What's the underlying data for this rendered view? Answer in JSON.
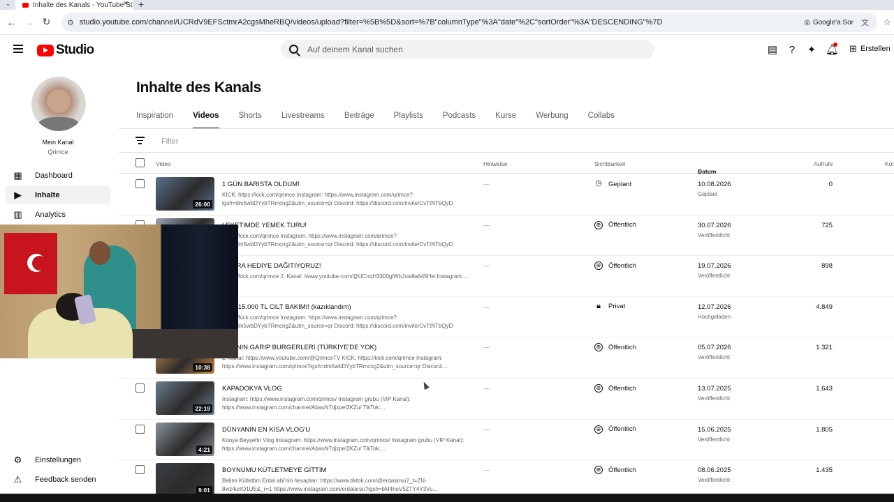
{
  "browser": {
    "tab_title": "Inhalte des Kanals - YouTube St",
    "url": "studio.youtube.com/channel/UCRdV9EFSctmrA2cgsMheRBQ/videos/upload?filter=%5B%5D&sort=%7B\"columnType\"%3A\"date\"%2C\"sortOrder\"%3A\"DESCENDING\"%7D",
    "lens_label": "Google'a Sor"
  },
  "header": {
    "brand": "Studio",
    "search_placeholder": "Auf deinem Kanal suchen",
    "create_label": "Erstellen"
  },
  "channel": {
    "name": "Mein Kanal",
    "handle": "Qrimce"
  },
  "sidebar": {
    "items": [
      {
        "label": "Dashboard",
        "icon": "dashboard-icon"
      },
      {
        "label": "Inhalte",
        "icon": "content-icon"
      },
      {
        "label": "Analytics",
        "icon": "analytics-icon"
      }
    ],
    "bottom": [
      {
        "label": "Einstellungen",
        "icon": "settings-icon"
      },
      {
        "label": "Feedback senden",
        "icon": "feedback-icon"
      }
    ]
  },
  "page": {
    "title": "Inhalte des Kanals",
    "tabs": [
      "Inspiration",
      "Videos",
      "Shorts",
      "Livestreams",
      "Beiträge",
      "Playlists",
      "Podcasts",
      "Kurse",
      "Werbung",
      "Collabs"
    ],
    "active_tab": "Videos",
    "filter_placeholder": "Filter"
  },
  "table": {
    "columns": {
      "video": "Video",
      "hints": "Hinweise",
      "visibility": "Sichtbarkeit",
      "date": "Datum",
      "views": "Aufrufe",
      "comments": "Kor"
    },
    "rows": [
      {
        "title": "1 GÜN BARISTA OLDUM!",
        "desc": "KICK: https://kick.com/qrimce Instagram: https://www.instagram.com/qrimce?igsh=dm5wbDYybTRmcng2&utm_source=qr Discord: https://discord.com/invite/CvTtNTbQyD",
        "duration": "26:00",
        "hint": "—",
        "visibility": "Geplant",
        "vis_icon": "clock-icon",
        "date": "10.08.2026",
        "date_sub": "Geplant",
        "views": "0"
      },
      {
        "title": "LEKETIMDE YEMEK TURU!",
        "desc": "https://kick.com/qrimce Instagram: https://www.instagram.com/qrimce?igsh=dm5wbDYybTRmcng2&utm_source=qr Discord: https://discord.com/invite/CvTtNTbQyD",
        "duration": "",
        "hint": "—",
        "visibility": "Öffentlich",
        "vis_icon": "globe-icon",
        "date": "30.07.2026",
        "date_sub": "Veröffentlicht",
        "views": "725"
      },
      {
        "title": "IKLARA HEDIYE DAĞITIYORUZ!",
        "desc": "https://kick.com/qrimce 2. Kanal: /www.youtube.com/@UCnqH3300giWhJvia8a645Hw Instagram:...",
        "duration": "",
        "hint": "—",
        "visibility": "Öffentlich",
        "vis_icon": "globe-icon",
        "date": "19.07.2026",
        "date_sub": "Veröffentlicht",
        "views": "898"
      },
      {
        "title": "L VS 15.000 TL CILT BAKIMI! (kazıklandım)",
        "desc": "https://kick.com/qrimce Instagram: https://www.instagram.com/qrimce?igsh=dm5wbDYybTRmcng2&utm_source=qr Discord: https://discord.com/invite/CvTtNTbQyD",
        "duration": "",
        "hint": "—",
        "visibility": "Privat",
        "vis_icon": "lock-icon",
        "date": "12.07.2026",
        "date_sub": "Hochgeladen",
        "views": "4.849"
      },
      {
        "title": "NYA'NIN GARIP BURGERLERİ (TÜRKİYE'DE YOK)",
        "desc": "2. Kanal: https://www.youtube.com/@QrimceTV KICK: https://kick.com/qrimce Instagram: https://www.instagram.com/qrimce?igsh=dm5wbDYybTRmcng2&utm_source=qr Discord:...",
        "duration": "10:38",
        "hint": "—",
        "visibility": "Öffentlich",
        "vis_icon": "globe-icon",
        "date": "05.07.2026",
        "date_sub": "Veröffentlicht",
        "views": "1.321"
      },
      {
        "title": "KAPADOKYA VLOG",
        "desc": "Instagram: https://www.instagram.com/qrimce/ Instagram grubu (VIP Kanal): https://www.instagram.com/channel/AbauN7djzpeI2KZu/ TikTok:...",
        "duration": "22:19",
        "hint": "—",
        "visibility": "Öffentlich",
        "vis_icon": "globe-icon",
        "date": "13.07.2025",
        "date_sub": "Veröffentlicht",
        "views": "1.643"
      },
      {
        "title": "DÜNYANIN EN KISA VLOG'U",
        "desc": "Konya Beyşehir Vlog Instagram: https://www.instagram.com/qrimce/ Instagram grubu (VIP Kanal): https://www.instagram.com/channel/AbauN7djzpeI2KZu/ TikTok:...",
        "duration": "4:21",
        "hint": "—",
        "visibility": "Öffentlich",
        "vis_icon": "globe-icon",
        "date": "15.06.2025",
        "date_sub": "Veröffentlicht",
        "views": "1.805"
      },
      {
        "title": "BOYNUMU KÜTLETMEYE GİTTİM",
        "desc": "Belimi Kütlettim Erdal abi'nin hesapları: https://www.tiktok.com/@erdalarsu?_t=ZN-8wz4urIO1UE&_r=1 https://www.instagram.com/erdalarsu?igsh=bM4hoV5ZTY4Y3Vu...",
        "duration": "9:01",
        "hint": "—",
        "visibility": "Öffentlich",
        "vis_icon": "globe-icon",
        "date": "08.06.2025",
        "date_sub": "Veröffentlicht",
        "views": "1.435"
      }
    ]
  },
  "thumb_colors": [
    "#5a6f8c",
    "#9aa6b4",
    "#7a5a4a",
    "#c7b09a",
    "#c78a4a",
    "#6b7d8c",
    "#8a949c",
    "#3a3f46"
  ]
}
